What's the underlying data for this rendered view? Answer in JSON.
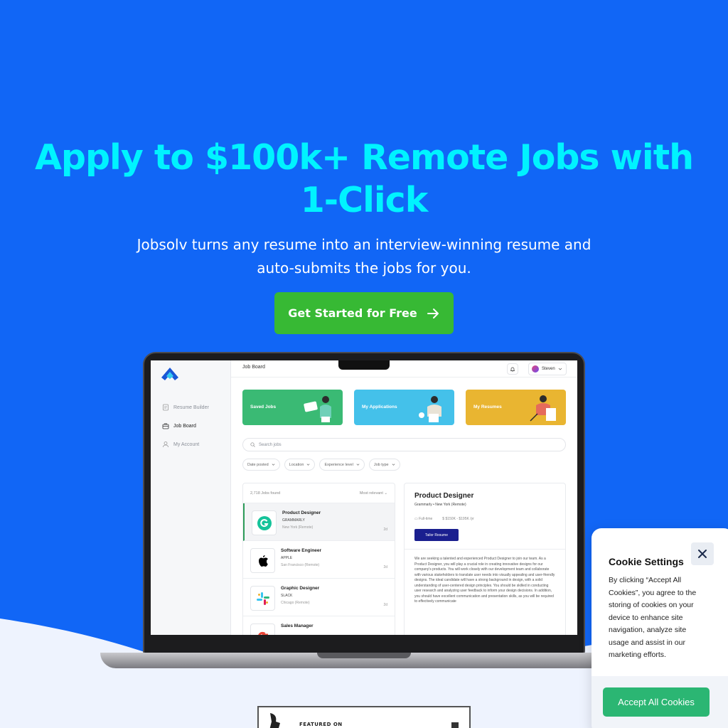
{
  "hero": {
    "headline": "Apply to $100k+ Remote Jobs with 1-Click",
    "subhead": "Jobsolv turns any resume into an interview-winning resume and auto-submits the jobs for you.",
    "cta_label": "Get Started for Free"
  },
  "app": {
    "sidebar": {
      "items": [
        {
          "label": "Resume Builder",
          "icon": "document-icon"
        },
        {
          "label": "Job Board",
          "icon": "briefcase-icon"
        },
        {
          "label": "My Account",
          "icon": "user-icon"
        }
      ]
    },
    "topbar": {
      "title": "Job Board",
      "user": "Steven"
    },
    "cards": [
      {
        "label": "Saved Jobs",
        "color": "#3aba74"
      },
      {
        "label": "My Applications",
        "color": "#44c1ea"
      },
      {
        "label": "My Resumes",
        "color": "#e9b531"
      }
    ],
    "search_placeholder": "Search jobs",
    "filters": [
      "Date posted",
      "Location",
      "Experience level",
      "Job type"
    ],
    "list": {
      "count": "2,718 Jobs found",
      "sort": "Most relevant",
      "jobs": [
        {
          "title": "Product Designer",
          "company": "GRAMMARLY",
          "location": "New York (Remote)",
          "age": "2d"
        },
        {
          "title": "Software Engineer",
          "company": "APPLE",
          "location": "San Francisco (Remote)",
          "age": "2d"
        },
        {
          "title": "Graphic Designer",
          "company": "SLACK",
          "location": "Chicago (Remote)",
          "age": "2d"
        },
        {
          "title": "Sales Manager",
          "company": "",
          "location": "",
          "age": ""
        }
      ]
    },
    "detail": {
      "title": "Product Designer",
      "company": "Grammarly",
      "location": "New York (Remote)",
      "type": "Full-time",
      "salary": "$150K - $195K /yr",
      "tailor_label": "Tailor Resume",
      "description": "We are seeking a talented and experienced Product Designer to join our team. As a Product Designer, you will play a crucial role in creating innovative designs for our company's products. You will work closely with our development team and collaborate with various stakeholders to translate user needs into visually appealing and user-friendly designs. The ideal candidate will have a strong background in design, with a solid understanding of user-centered design principles. You should be skilled in conducting user research and analyzing user feedback to inform your design decisions. In addition, you should have excellent communication and presentation skills, as you will be required to effectively communicate"
    }
  },
  "cookie": {
    "title": "Cookie Settings",
    "body": "By clicking “Accept All Cookies”, you agree to the storing of cookies on your device to enhance site navigation, analyze site usage and assist in our marketing efforts.",
    "accept_label": "Accept All Cookies"
  },
  "featured": {
    "label": "FEATURED ON"
  },
  "colors": {
    "hero_bg": "#1166f6",
    "headline": "#00f3ff",
    "cta": "#37b934",
    "accept": "#2bb673"
  }
}
